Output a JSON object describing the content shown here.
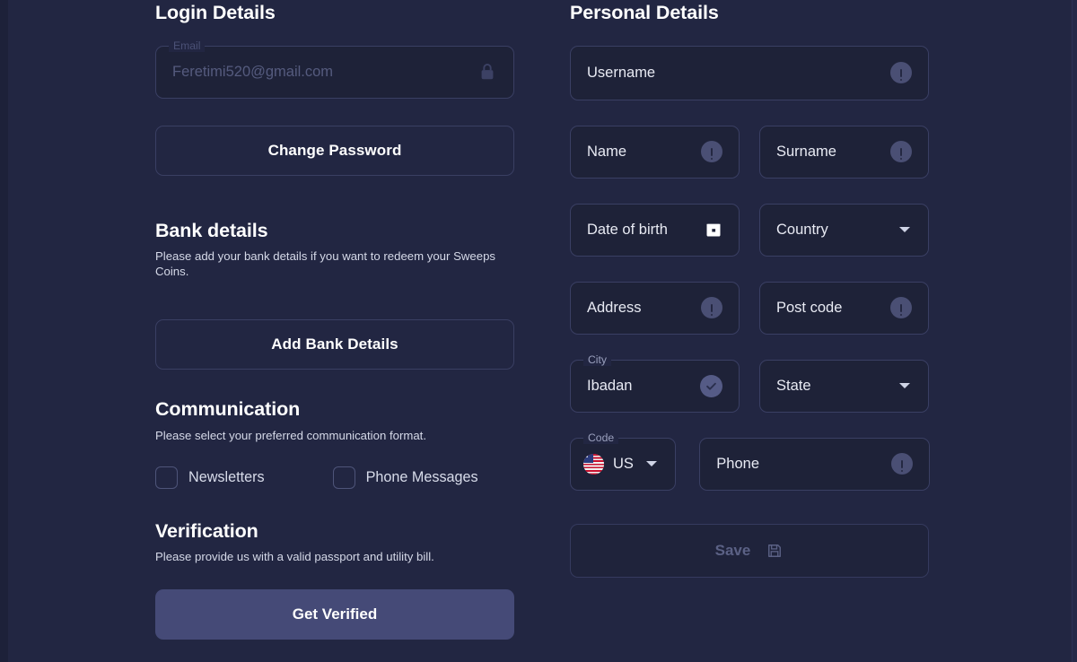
{
  "theme": {
    "page_bg": "#222642",
    "field_bg": "#1e2238",
    "field_border": "#3a3f63",
    "accent_button": "#454a77",
    "badge_alert": "#4a4f74",
    "badge_check": "#555b86",
    "text_primary": "#ffffff",
    "text_secondary": "#d5d9e8",
    "text_disabled": "#5b6185"
  },
  "login": {
    "title": "Login Details",
    "email": {
      "label": "Email",
      "value": "Feretimi520@gmail.com",
      "icon": "lock-icon"
    },
    "change_password_label": "Change Password"
  },
  "bank": {
    "title": "Bank details",
    "description": "Please add your bank details if you want to redeem your Sweeps Coins.",
    "add_button_label": "Add Bank Details"
  },
  "communication": {
    "title": "Communication",
    "description": "Please select your preferred communication format.",
    "options": [
      {
        "label": "Newsletters",
        "checked": false
      },
      {
        "label": "Phone Messages",
        "checked": false
      }
    ]
  },
  "verification": {
    "title": "Verification",
    "description": "Please provide us with a valid passport and utility bill.",
    "button_label": "Get Verified"
  },
  "personal": {
    "title": "Personal Details",
    "fields": {
      "username": {
        "placeholder": "Username",
        "value": "",
        "icon": "alert-circle-icon"
      },
      "name": {
        "placeholder": "Name",
        "value": "",
        "icon": "alert-circle-icon"
      },
      "surname": {
        "placeholder": "Surname",
        "value": "",
        "icon": "alert-circle-icon"
      },
      "date_of_birth": {
        "placeholder": "Date of birth",
        "value": "",
        "icon": "calendar-icon"
      },
      "country": {
        "placeholder": "Country",
        "value": "",
        "icon": "chevron-down-icon"
      },
      "address": {
        "placeholder": "Address",
        "value": "",
        "icon": "alert-circle-icon"
      },
      "post_code": {
        "placeholder": "Post code",
        "value": "",
        "icon": "alert-circle-icon"
      },
      "city": {
        "label": "City",
        "value": "Ibadan",
        "icon": "check-circle-icon"
      },
      "state": {
        "placeholder": "State",
        "value": "",
        "icon": "chevron-down-icon"
      },
      "code": {
        "label": "Code",
        "value": "US",
        "flag": "us-flag-icon",
        "icon": "chevron-down-icon"
      },
      "phone": {
        "placeholder": "Phone",
        "value": "",
        "icon": "alert-circle-icon"
      }
    },
    "save": {
      "label": "Save",
      "icon": "save-disk-icon",
      "disabled": true
    }
  }
}
